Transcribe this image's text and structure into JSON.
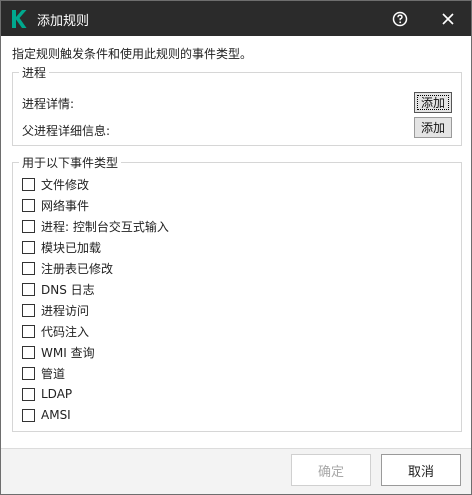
{
  "window": {
    "title": "添加规则"
  },
  "instruction": "指定规则触发条件和使用此规则的事件类型。",
  "process_group": {
    "legend": "进程",
    "rows": [
      {
        "label": "进程详情:",
        "button": "添加"
      },
      {
        "label": "父进程详细信息:",
        "button": "添加"
      }
    ]
  },
  "events_group": {
    "legend": "用于以下事件类型",
    "items": [
      {
        "label": "文件修改",
        "checked": false
      },
      {
        "label": "网络事件",
        "checked": false
      },
      {
        "label": "进程: 控制台交互式输入",
        "checked": false
      },
      {
        "label": "模块已加载",
        "checked": false
      },
      {
        "label": "注册表已修改",
        "checked": false
      },
      {
        "label": "DNS 日志",
        "checked": false
      },
      {
        "label": "进程访问",
        "checked": false
      },
      {
        "label": "代码注入",
        "checked": false
      },
      {
        "label": "WMI 查询",
        "checked": false
      },
      {
        "label": "管道",
        "checked": false
      },
      {
        "label": "LDAP",
        "checked": false
      },
      {
        "label": "AMSI",
        "checked": false
      }
    ]
  },
  "footer": {
    "ok_label": "确定",
    "cancel_label": "取消",
    "ok_enabled": false
  },
  "icons": {
    "logo": "kaspersky-k-icon",
    "help": "help-circle-icon",
    "close": "close-icon"
  },
  "colors": {
    "titlebar": "#2b2b2b",
    "logo": "#00a88e"
  }
}
